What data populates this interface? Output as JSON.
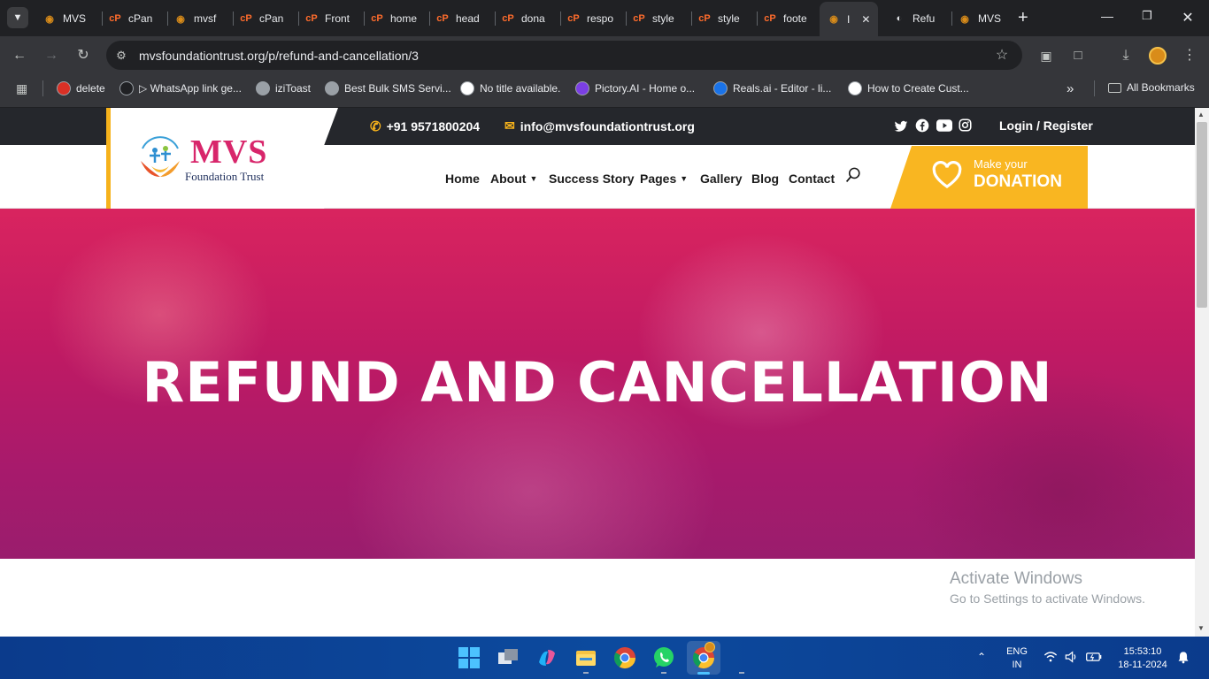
{
  "browser": {
    "tabs": [
      {
        "label": "MVS",
        "icon": "mvs-favicon"
      },
      {
        "label": "cPan",
        "icon": "cpanel-icon"
      },
      {
        "label": "mvsf",
        "icon": "mvs-favicon"
      },
      {
        "label": "cPan",
        "icon": "cpanel-icon"
      },
      {
        "label": "Front",
        "icon": "cpanel-icon"
      },
      {
        "label": "home",
        "icon": "cpanel-icon"
      },
      {
        "label": "head",
        "icon": "cpanel-icon"
      },
      {
        "label": "dona",
        "icon": "cpanel-icon"
      },
      {
        "label": "respo",
        "icon": "cpanel-icon"
      },
      {
        "label": "style",
        "icon": "cpanel-icon"
      },
      {
        "label": "style",
        "icon": "cpanel-icon"
      },
      {
        "label": "foote",
        "icon": "cpanel-icon"
      },
      {
        "label": "I",
        "icon": "mvs-favicon"
      },
      {
        "label": "Refu",
        "icon": "globe-icon"
      },
      {
        "label": "MVS",
        "icon": "mvs-favicon"
      }
    ],
    "active_tab_index": 12,
    "url": "mvsfoundationtrust.org/p/refund-and-cancellation/3",
    "bookmarks": [
      {
        "label": "delete",
        "color": "#d93025"
      },
      {
        "label": "▷ WhatsApp link ge...",
        "color": "#202124"
      },
      {
        "label": "iziToast",
        "color": "#9aa0a6"
      },
      {
        "label": "Best Bulk SMS Servi...",
        "color": "#9aa0a6"
      },
      {
        "label": "No title available.",
        "color": "#ffffff"
      },
      {
        "label": "Pictory.AI - Home o...",
        "color": "#7b3fe4"
      },
      {
        "label": "Reals.ai - Editor - li...",
        "color": "#1a73e8"
      },
      {
        "label": "How to Create Cust...",
        "color": "#ffffff"
      }
    ],
    "all_bookmarks": "All Bookmarks",
    "more": "»"
  },
  "site": {
    "topbar": {
      "phone": "+91 9571800204",
      "email": "info@mvsfoundationtrust.org",
      "login": "Login / Register",
      "social_icons": [
        "twitter-icon",
        "facebook-icon",
        "youtube-icon",
        "instagram-icon"
      ]
    },
    "logo": {
      "title": "MVS",
      "subtitle": "Foundation Trust",
      "ribbon": "MVS FOUNDATION TRUST"
    },
    "nav": [
      {
        "label": "Home",
        "dropdown": false
      },
      {
        "label": "About",
        "dropdown": true
      },
      {
        "label": "Success Story",
        "dropdown": false
      },
      {
        "label": "Pages",
        "dropdown": true
      },
      {
        "label": "Gallery",
        "dropdown": false
      },
      {
        "label": "Blog",
        "dropdown": false
      },
      {
        "label": "Contact",
        "dropdown": false
      }
    ],
    "donate": {
      "line1": "Make your",
      "line2": "DONATION"
    },
    "hero_title": "REFUND AND CANCELLATION",
    "colors": {
      "accent": "#f9b621",
      "brand_pink": "#d9245f",
      "topbar": "#25272c"
    }
  },
  "watermark": {
    "title": "Activate Windows",
    "subtitle": "Go to Settings to activate Windows."
  },
  "taskbar": {
    "lang_top": "ENG",
    "lang_bottom": "IN",
    "time": "15:53:10",
    "date": "18-11-2024"
  }
}
